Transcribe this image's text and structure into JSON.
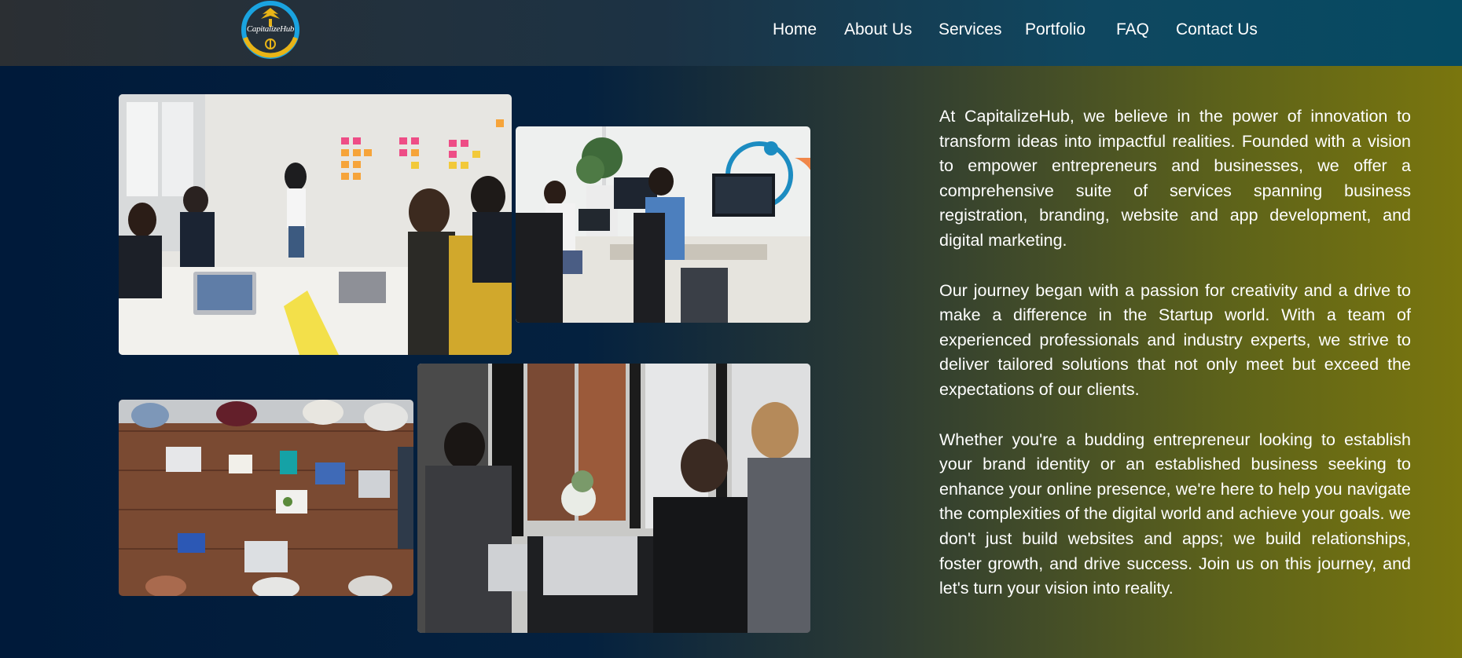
{
  "brand": {
    "logo_text": "CapitalizeHub",
    "colors": {
      "logo_blue": "#1aa3e0",
      "logo_gold": "#e8b417"
    }
  },
  "nav": {
    "items": [
      {
        "label": "Home"
      },
      {
        "label": "About Us"
      },
      {
        "label": "Services"
      },
      {
        "label": "Portfolio"
      },
      {
        "label": "FAQ"
      },
      {
        "label": "Contact Us"
      }
    ]
  },
  "about": {
    "paragraphs": [
      "At CapitalizeHub, we believe in the power of innovation to transform ideas into impactful realities. Founded with a vision to empower entrepreneurs and businesses, we offer a comprehensive suite of services spanning business registration, branding, website and app development, and digital marketing.",
      "Our journey began with a passion for creativity and a drive to make a difference in the Startup world. With a team of experienced professionals and industry experts, we strive to deliver tailored solutions that not only meet but exceed the expectations of our clients.",
      "Whether you're a budding entrepreneur looking to establish your brand identity or an established business seeking to enhance your online presence, we're here to help you navigate the complexities of the digital world and achieve your goals. we don't just build websites and apps; we build relationships, foster growth, and drive success. Join us on this journey, and let's turn your vision into reality."
    ]
  },
  "photos": [
    {
      "name": "team-meeting-whiteboard-photo"
    },
    {
      "name": "developers-at-monitors-photo"
    },
    {
      "name": "overhead-desk-laptops-photo"
    },
    {
      "name": "team-working-laptops-photo"
    }
  ],
  "theme": {
    "background_left": "#001a3a",
    "background_right": "#7a760e",
    "header_left": "#2b2f33",
    "header_right": "#064a62"
  }
}
